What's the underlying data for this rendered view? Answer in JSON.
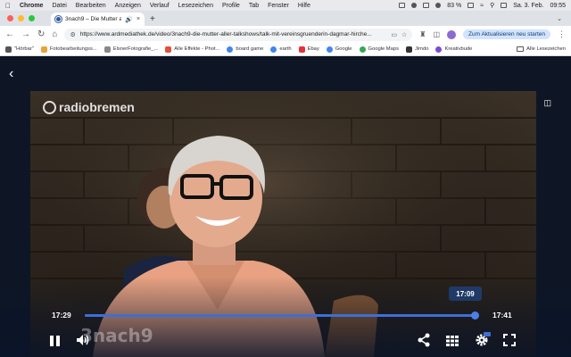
{
  "menubar": {
    "app_name": "Chrome",
    "menus": [
      "Datei",
      "Bearbeiten",
      "Anzeigen",
      "Verlauf",
      "Lesezeichen",
      "Profile",
      "Tab",
      "Fenster",
      "Hilfe"
    ],
    "battery": "83 %",
    "date": "Sa. 3. Feb.",
    "time": "09:55"
  },
  "tab": {
    "title": "3nach9 – Die Mutter alle",
    "close": "×"
  },
  "new_tab": "+",
  "toolbar": {
    "url": "https://www.ardmediathek.de/video/3nach9-die-mutter-aller-talkshows/talk-mit-vereinsgruenderin-dagmar-hirche...",
    "update_button": "Zum Aktualisieren neu starten"
  },
  "bookmarks": {
    "items": [
      {
        "label": "\"Hörbar\"",
        "color": "#555555"
      },
      {
        "label": "Fotobearbeitungss...",
        "color": "#e8a23a"
      },
      {
        "label": "ElsnerFotografie_...",
        "color": "#888888"
      },
      {
        "label": "Alle Effekte - Phot...",
        "color": "#e0503a"
      },
      {
        "label": "board game",
        "color": "#4285f4"
      },
      {
        "label": "earth",
        "color": "#4285f4"
      },
      {
        "label": "Ebay",
        "color": "#e53238"
      },
      {
        "label": "Google",
        "color": "#4285f4"
      },
      {
        "label": "Google Maps",
        "color": "#34a853"
      },
      {
        "label": "Jimdo",
        "color": "#333333"
      },
      {
        "label": "Kreativbude",
        "color": "#7b4bd6"
      }
    ],
    "all_bookmarks": "Alle Lesezeichen"
  },
  "player": {
    "broadcaster_logo": "radiobremen",
    "channel_logo": "3nach9",
    "hover_time": "17:09",
    "current_time": "17:29",
    "end_time": "17:41",
    "progress_fraction": 0.994
  },
  "colors": {
    "accent": "#3d6fd6",
    "tooltip_bg": "#1f3a66",
    "page_bg": "#0e1626"
  }
}
